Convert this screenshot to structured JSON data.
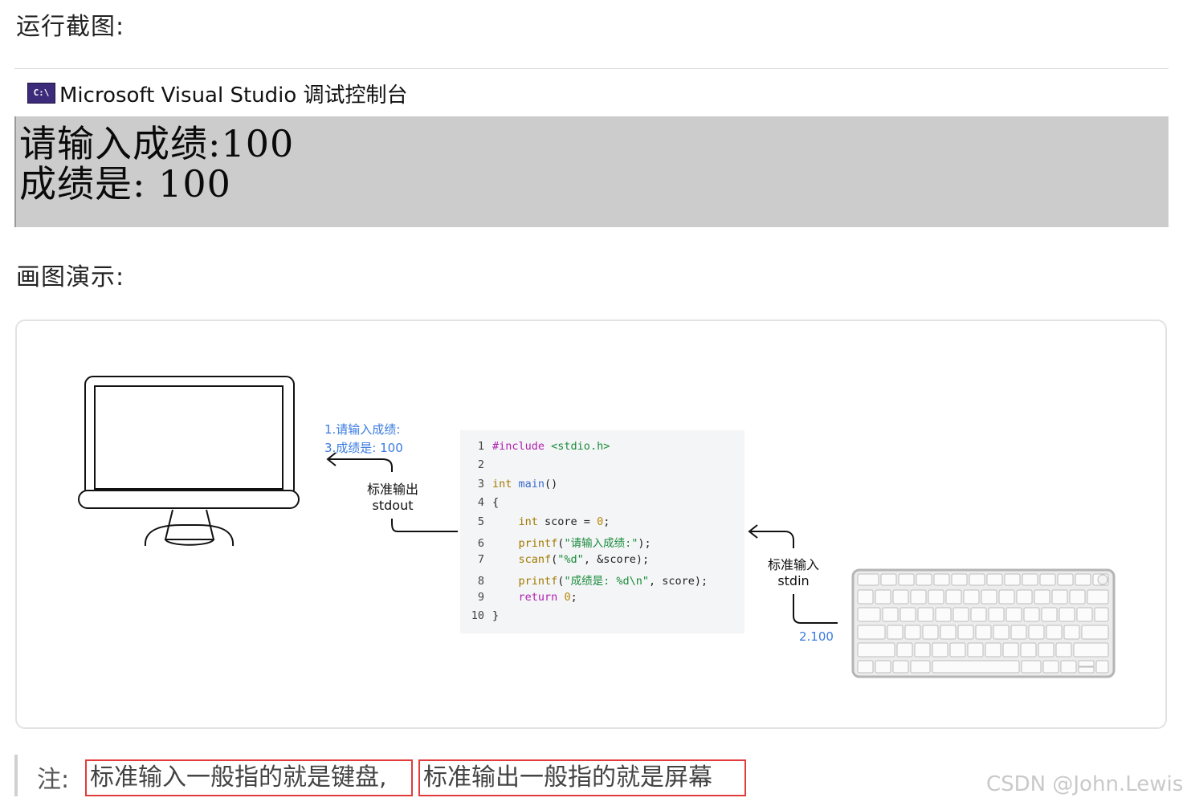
{
  "headings": {
    "run_screenshot": "运行截图:",
    "drawing_demo": "画图演示:"
  },
  "console": {
    "title": "Microsoft Visual Studio 调试控制台",
    "icon_label": "C:\\",
    "lines": [
      "请输入成绩:100",
      "成绩是:  100"
    ]
  },
  "diagram": {
    "output_items": [
      "1.请输入成绩:",
      "3.成绩是:  100"
    ],
    "stdout_label": "标准输出",
    "stdout_name": "stdout",
    "stdin_label": "标准输入",
    "stdin_name": "stdin",
    "input_value": "2.100",
    "code": [
      "#include <stdio.h>",
      "",
      "int main()",
      "{",
      "    int score = 0;",
      "    printf(\"请输入成绩:\");",
      "    scanf(\"%d\", &score);",
      "    printf(\"成绩是: %d\\n\", score);",
      "    return 0;",
      "}"
    ],
    "line_numbers": [
      "1",
      "2",
      "3",
      "4",
      "5",
      "6",
      "7",
      "8",
      "9",
      "10"
    ],
    "monitor_icon": "monitor-icon",
    "keyboard_icon": "keyboard-icon"
  },
  "note": {
    "prefix": "注:",
    "part1": "标准输入一般指的就是键盘,",
    "part2": "标准输出一般指的就是屏幕"
  },
  "watermark": "CSDN @John.Lewis",
  "colors": {
    "console_bg": "#cccccc",
    "highlight_border": "#e23b3b",
    "blue_text": "#3a7be0",
    "code_bg": "#f4f5f6"
  }
}
